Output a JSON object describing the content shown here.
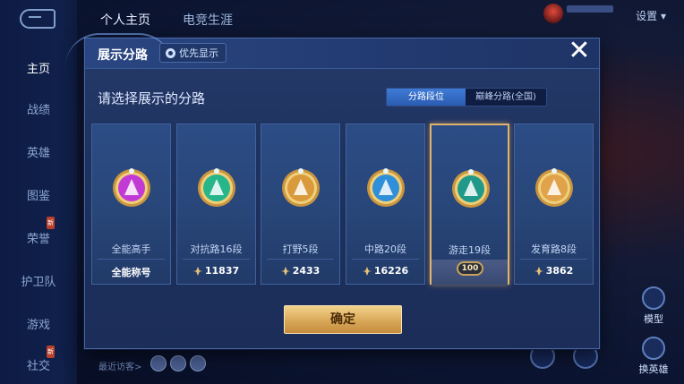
{
  "background": {
    "top_tabs": [
      "个人主页",
      "电竞生涯"
    ],
    "settings_label": "设置",
    "nav": [
      "主页",
      "战绩",
      "英雄",
      "图鉴",
      "荣誉",
      "护卫队",
      "游戏",
      "社交"
    ],
    "visitors_label": "最近访客>",
    "right_buttons": [
      "模型",
      "换英雄"
    ]
  },
  "modal": {
    "title": "展示分路",
    "priority_label": "优先显示",
    "close_glyph": "✕",
    "subtitle": "请选择展示的分路",
    "toggle": [
      "分路段位",
      "巅峰分路(全国)"
    ],
    "confirm_label": "确定"
  },
  "cards": [
    {
      "label": "全能高手",
      "value": "全能称号",
      "badge_color": "#c23ad6",
      "show_score_icon": false
    },
    {
      "label": "对抗路16段",
      "value": "11837",
      "badge_color": "#27b58a",
      "show_score_icon": true
    },
    {
      "label": "打野5段",
      "value": "2433",
      "badge_color": "#d89a3a",
      "show_score_icon": true
    },
    {
      "label": "中路20段",
      "value": "16226",
      "badge_color": "#2f8fd8",
      "show_score_icon": true
    },
    {
      "label": "游走19段",
      "value": "100",
      "badge_color": "#1f9a8a",
      "show_score_icon": false,
      "selected": true
    },
    {
      "label": "发育路8段",
      "value": "3862",
      "badge_color": "#e0a24a",
      "show_score_icon": true
    }
  ]
}
